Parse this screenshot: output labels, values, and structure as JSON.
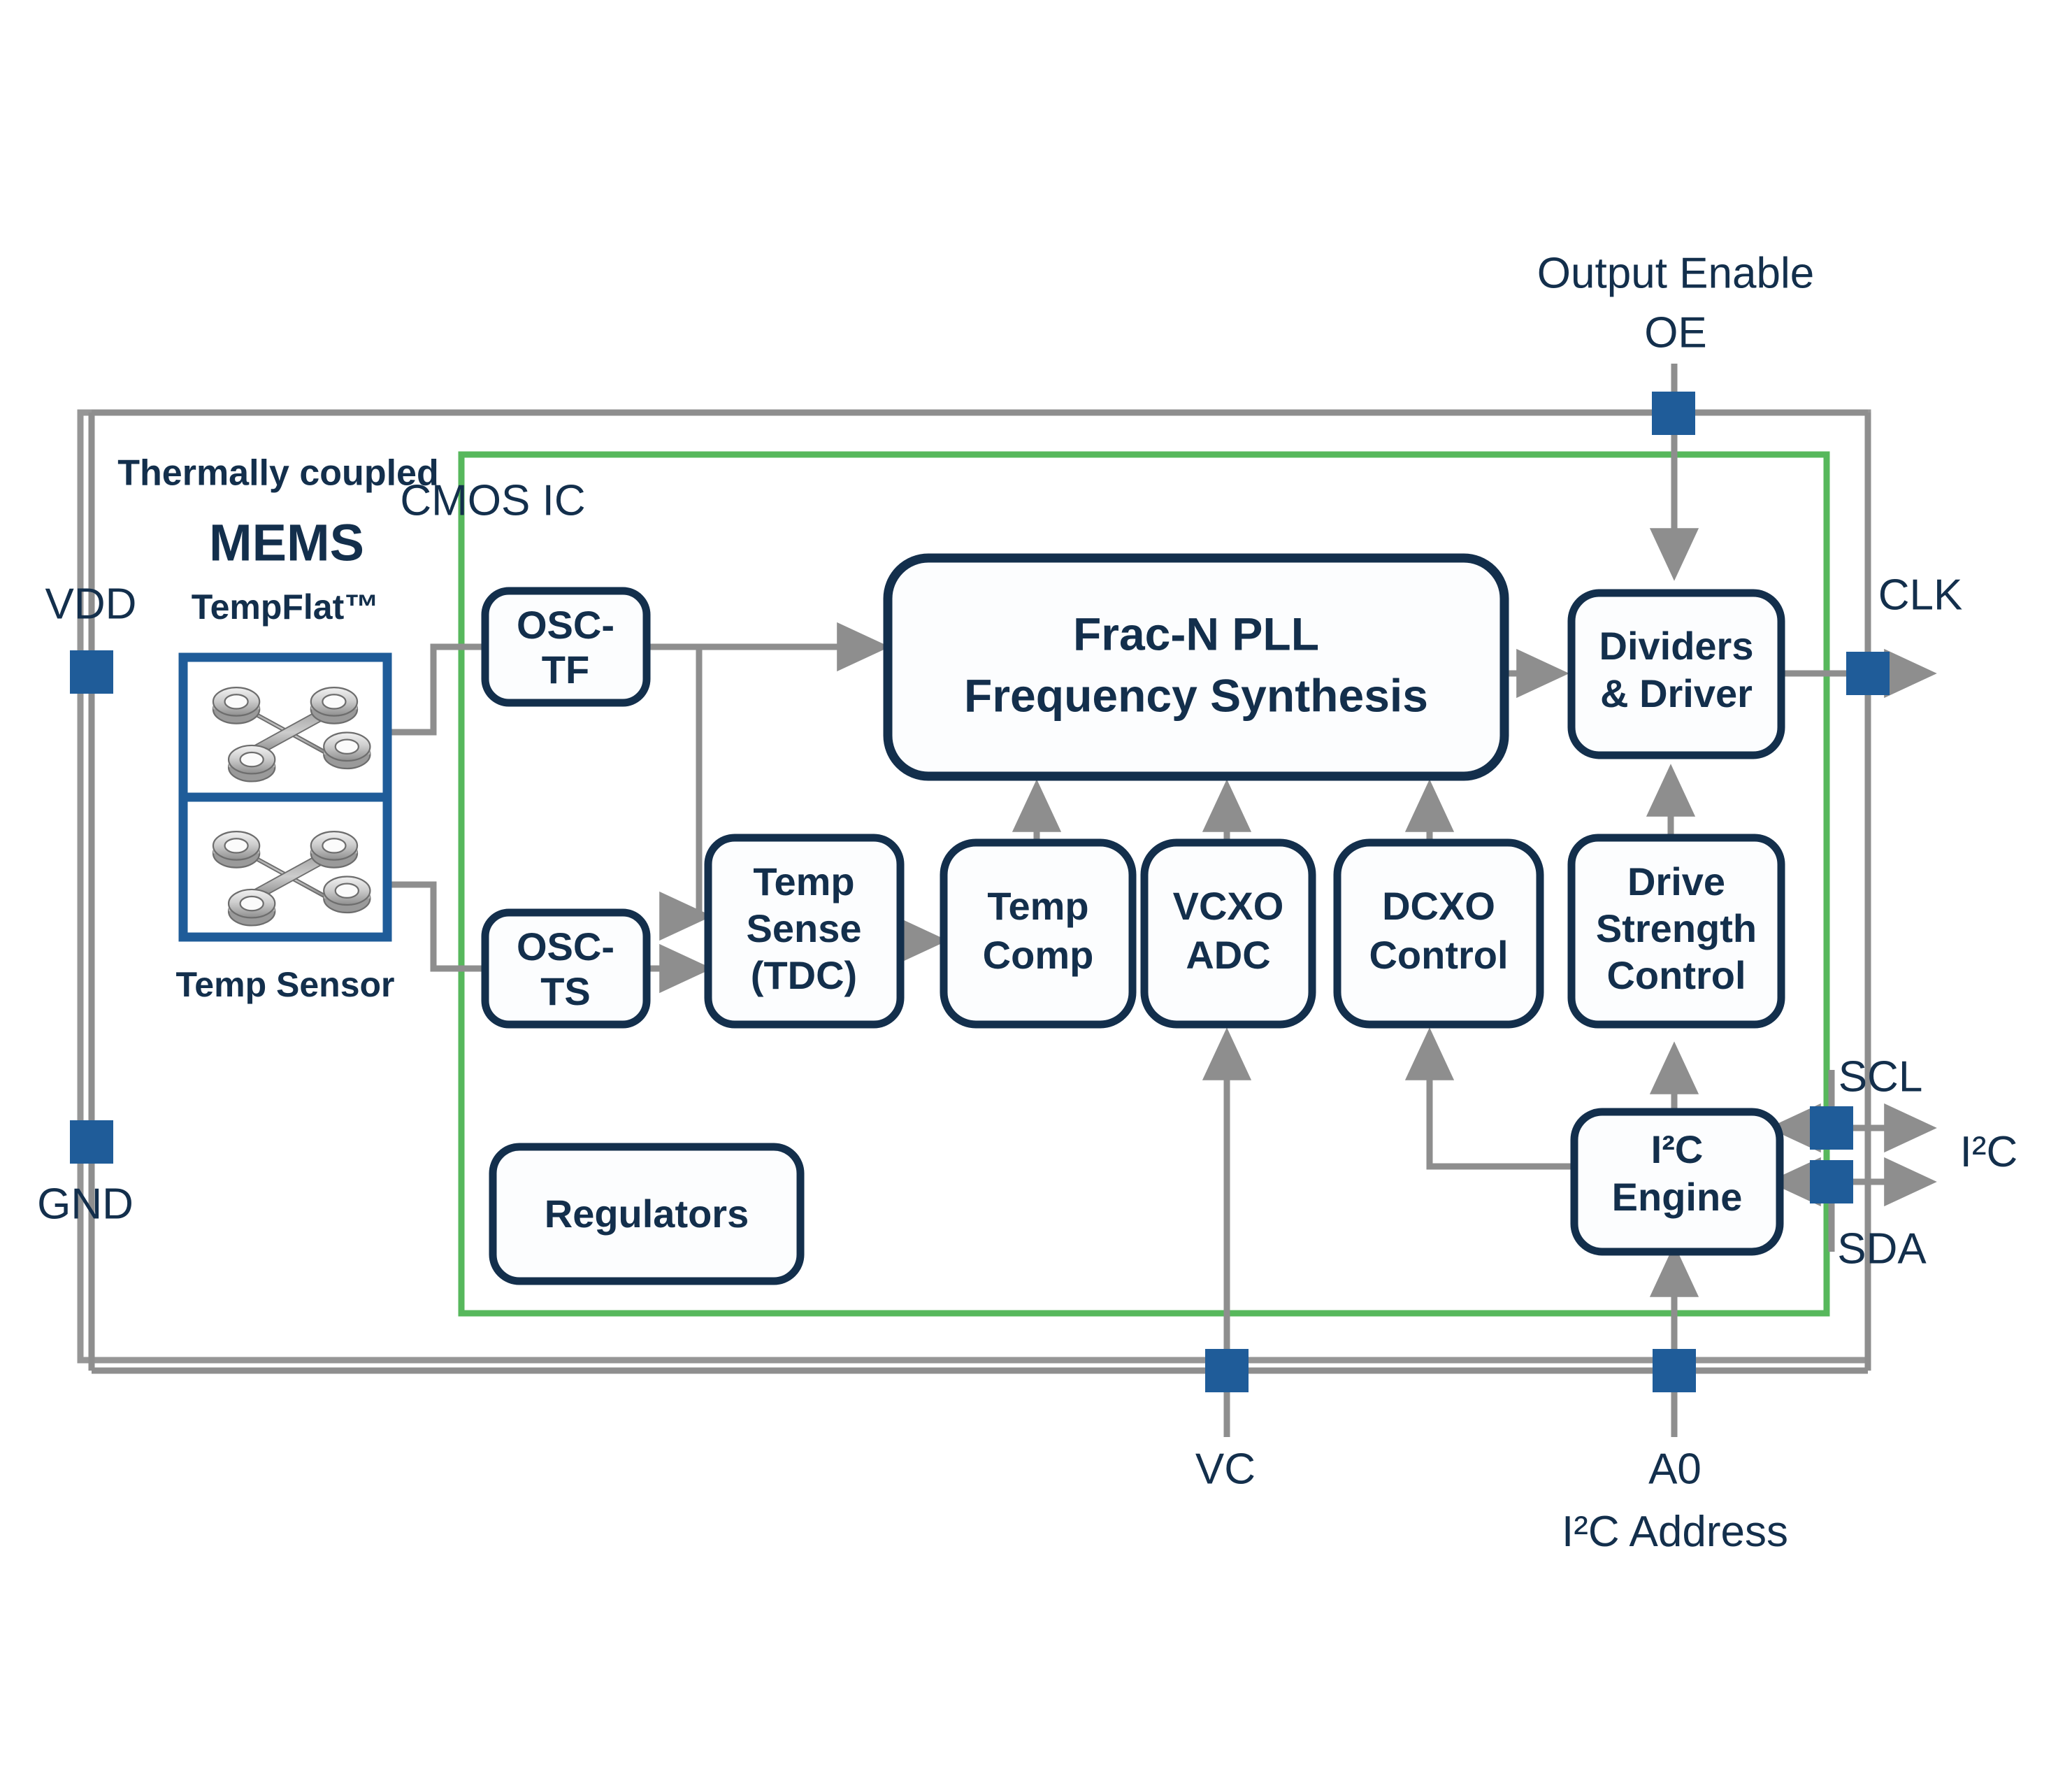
{
  "diagram": {
    "title": "MEMS oscillator CMOS IC block diagram",
    "colors": {
      "block_border": "#132f4c",
      "block_fill": "#fcfdfe",
      "wire": "#8e8e8e",
      "pin_square": "#1f5c99",
      "mems_border": "#1f5c99",
      "cmos_boundary": "#5cb85c",
      "package_boundary": "#8e8e8e",
      "text": "#132f4c"
    },
    "boundaries": {
      "package_label": "",
      "cmos_label": "CMOS IC"
    },
    "mems": {
      "heading": "Thermally coupled",
      "title": "MEMS",
      "top_label": "TempFlat™",
      "bottom_label": "Temp Sensor"
    },
    "blocks": [
      {
        "id": "osc-tf",
        "lines": [
          "OSC-",
          "TF"
        ]
      },
      {
        "id": "osc-ts",
        "lines": [
          "OSC-",
          "TS"
        ]
      },
      {
        "id": "temp-sense",
        "lines": [
          "Temp",
          "Sense",
          "(TDC)"
        ]
      },
      {
        "id": "temp-comp",
        "lines": [
          "Temp",
          "Comp"
        ]
      },
      {
        "id": "vcxo-adc",
        "lines": [
          "VCXO",
          "ADC"
        ]
      },
      {
        "id": "dcxo-control",
        "lines": [
          "DCXO",
          "Control"
        ]
      },
      {
        "id": "drive-strength",
        "lines": [
          "Drive",
          "Strength",
          "Control"
        ]
      },
      {
        "id": "frac-n-pll",
        "lines": [
          "Frac-N PLL",
          "Frequency Synthesis"
        ]
      },
      {
        "id": "dividers",
        "lines": [
          "Dividers",
          "& Driver"
        ]
      },
      {
        "id": "i2c-engine",
        "lines": [
          "I²C",
          "Engine"
        ]
      },
      {
        "id": "regulators",
        "lines": [
          "Regulators"
        ]
      }
    ],
    "pins": [
      {
        "id": "oe",
        "label_lines": [
          "Output Enable",
          "OE"
        ],
        "position": "top"
      },
      {
        "id": "vdd",
        "label_lines": [
          "VDD"
        ],
        "position": "left"
      },
      {
        "id": "gnd",
        "label_lines": [
          "GND"
        ],
        "position": "left"
      },
      {
        "id": "clk",
        "label_lines": [
          "CLK"
        ],
        "position": "right"
      },
      {
        "id": "scl",
        "label_lines": [
          "SCL"
        ],
        "position": "right"
      },
      {
        "id": "sda",
        "label_lines": [
          "SDA"
        ],
        "position": "right"
      },
      {
        "id": "i2c",
        "label_lines": [
          "I²C"
        ],
        "position": "right"
      },
      {
        "id": "vc",
        "label_lines": [
          "VC"
        ],
        "position": "bottom"
      },
      {
        "id": "a0",
        "label_lines": [
          "A0",
          "I²C Address"
        ],
        "position": "bottom"
      }
    ]
  }
}
